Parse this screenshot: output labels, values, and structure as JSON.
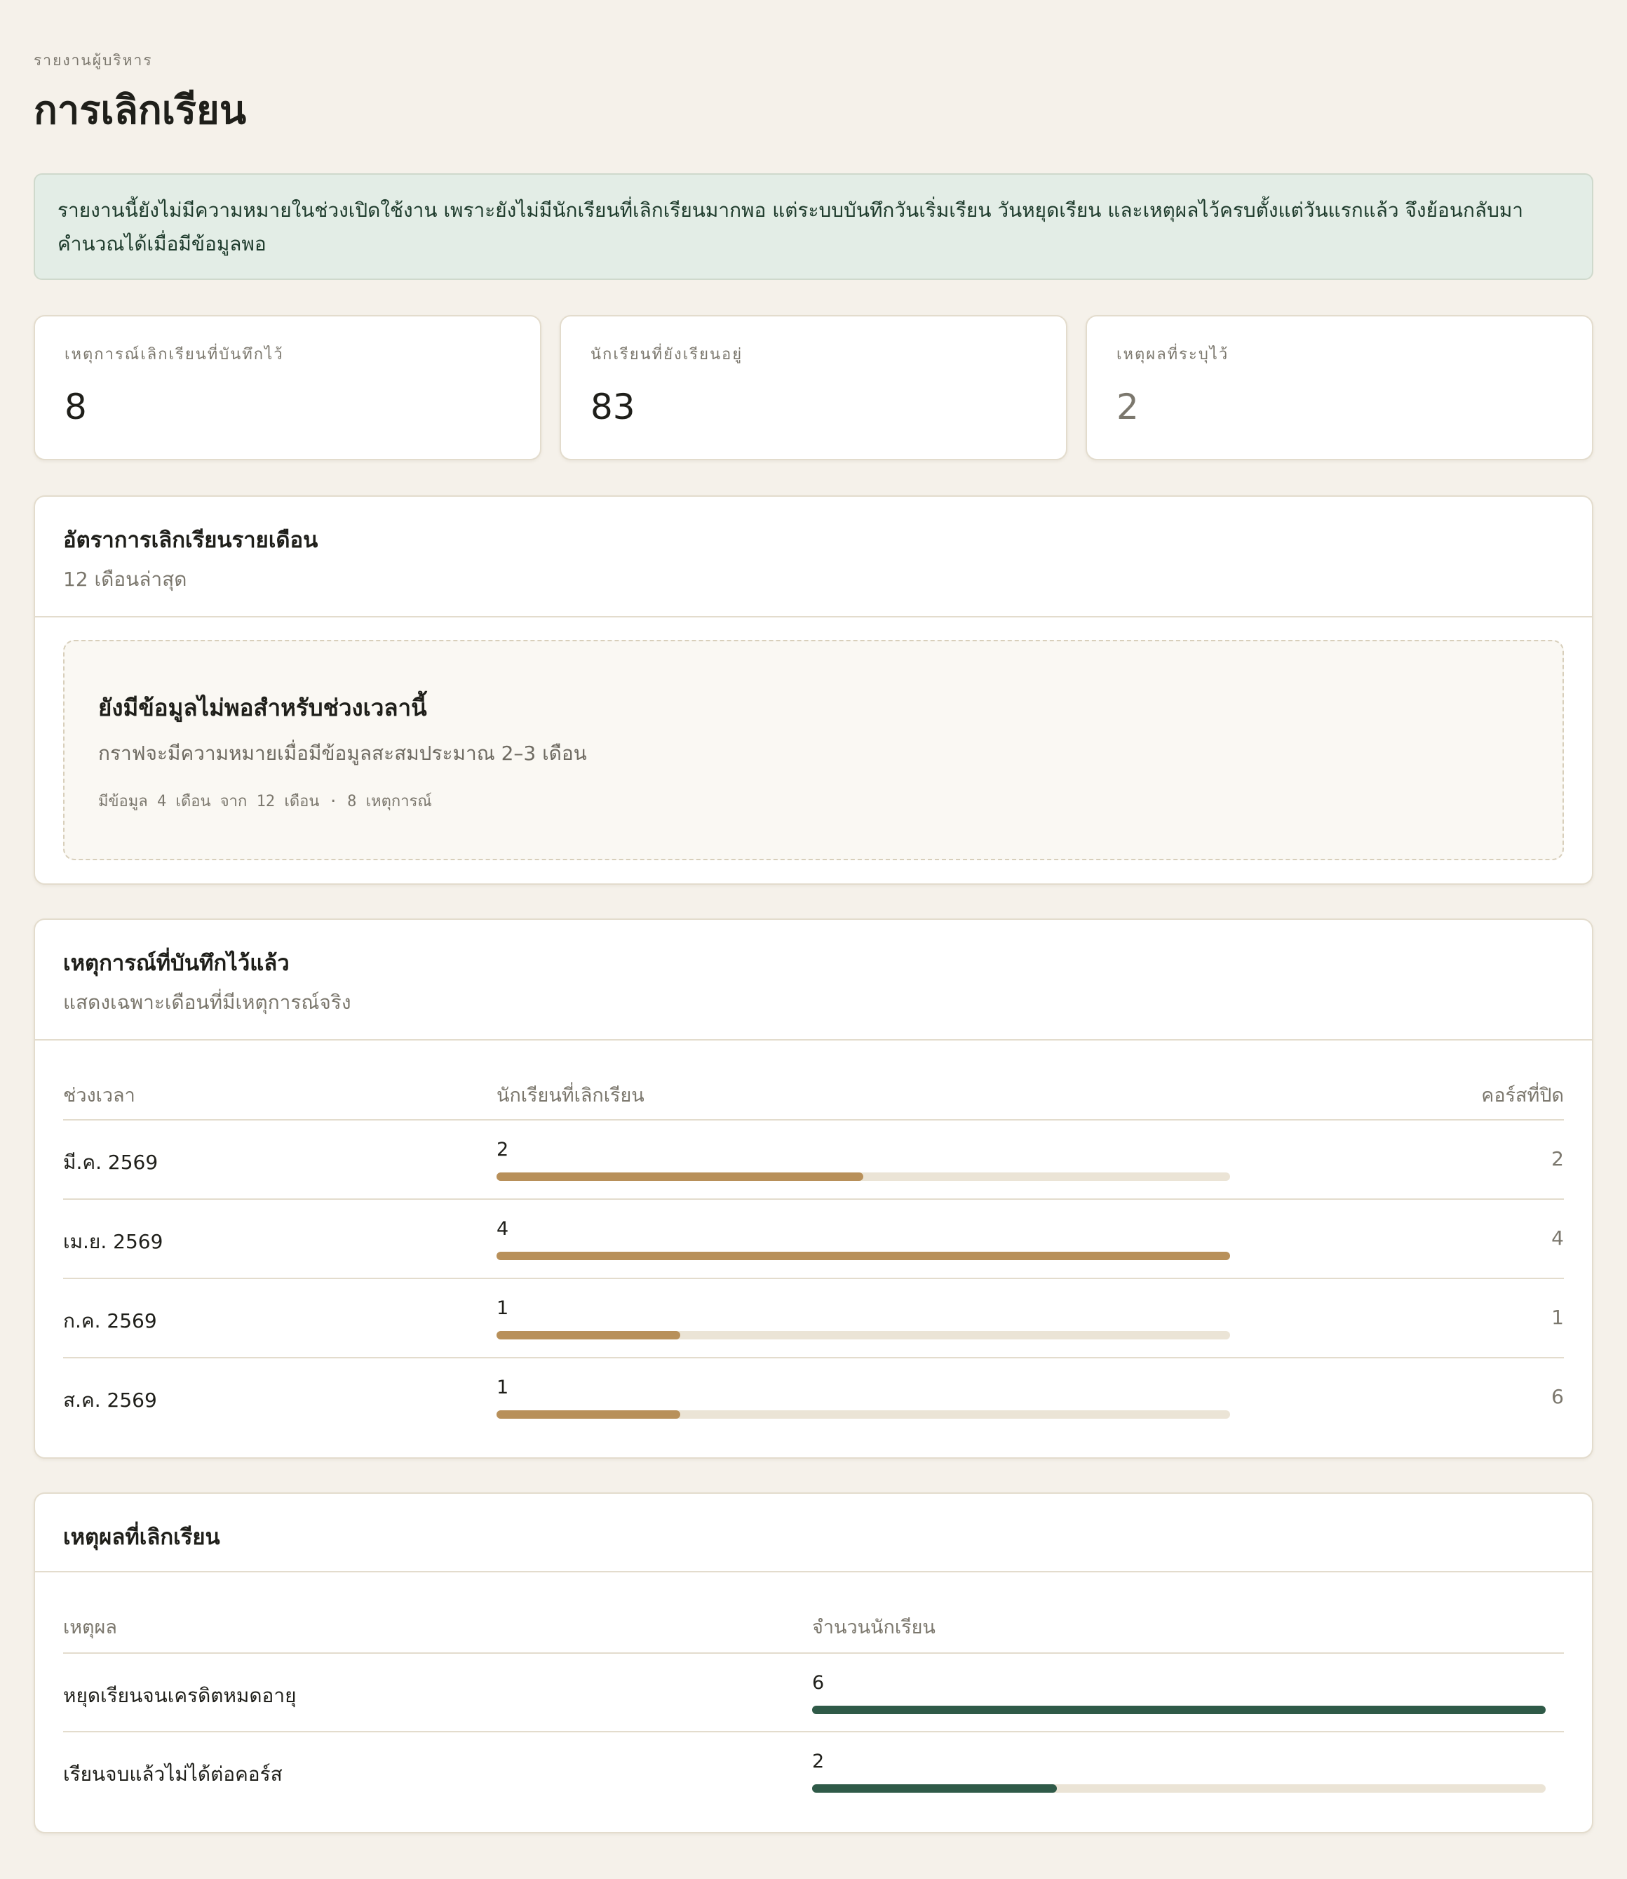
{
  "header": {
    "eyebrow": "รายงานผู้บริหาร",
    "title": "การเลิกเรียน"
  },
  "notice": "รายงานนี้ยังไม่มีความหมายในช่วงเปิดใช้งาน เพราะยังไม่มีนักเรียนที่เลิกเรียนมากพอ แต่ระบบบันทึกวันเริ่มเรียน วันหยุดเรียน และเหตุผลไว้ครบตั้งแต่วันแรกแล้ว จึงย้อนกลับมาคำนวณได้เมื่อมีข้อมูลพอ",
  "stats": [
    {
      "label": "เหตุการณ์เลิกเรียนที่บันทึกไว้",
      "value": "8"
    },
    {
      "label": "นักเรียนที่ยังเรียนอยู่",
      "value": "83"
    },
    {
      "label": "เหตุผลที่ระบุไว้",
      "value": "2"
    }
  ],
  "monthly": {
    "title": "อัตราการเลิกเรียนรายเดือน",
    "subtitle": "12 เดือนล่าสุด",
    "empty_title": "ยังมีข้อมูลไม่พอสำหรับช่วงเวลานี้",
    "empty_desc": "กราฟจะมีความหมายเมื่อมีข้อมูลสะสมประมาณ 2–3 เดือน",
    "empty_meta": "มีข้อมูล 4 เดือน จาก 12 เดือน · 8 เหตุการณ์"
  },
  "events": {
    "title": "เหตุการณ์ที่บันทึกไว้แล้ว",
    "subtitle": "แสดงเฉพาะเดือนที่มีเหตุการณ์จริง",
    "columns": [
      "ช่วงเวลา",
      "นักเรียนที่เลิกเรียน",
      "คอร์สที่ปิด"
    ],
    "bar_max": 4,
    "rows": [
      {
        "period": "มี.ค. 2569",
        "students": 2,
        "students_label": "2",
        "courses": "2"
      },
      {
        "period": "เม.ย. 2569",
        "students": 4,
        "students_label": "4",
        "courses": "4"
      },
      {
        "period": "ก.ค. 2569",
        "students": 1,
        "students_label": "1",
        "courses": "1"
      },
      {
        "period": "ส.ค. 2569",
        "students": 1,
        "students_label": "1",
        "courses": "6"
      }
    ]
  },
  "reasons": {
    "title": "เหตุผลที่เลิกเรียน",
    "columns": [
      "เหตุผล",
      "จำนวนนักเรียน"
    ],
    "bar_max": 6,
    "rows": [
      {
        "reason": "หยุดเรียนจนเครดิตหมดอายุ",
        "count": 6,
        "count_label": "6"
      },
      {
        "reason": "เรียนจบแล้วไม่ได้ต่อคอร์ส",
        "count": 2,
        "count_label": "2"
      }
    ]
  },
  "colors": {
    "background": "#f5f1ea",
    "events_bar": "#b8905a",
    "reasons_bar": "#2f5a48",
    "track": "#ebe4d6",
    "notice_bg": "#e3ede6"
  }
}
